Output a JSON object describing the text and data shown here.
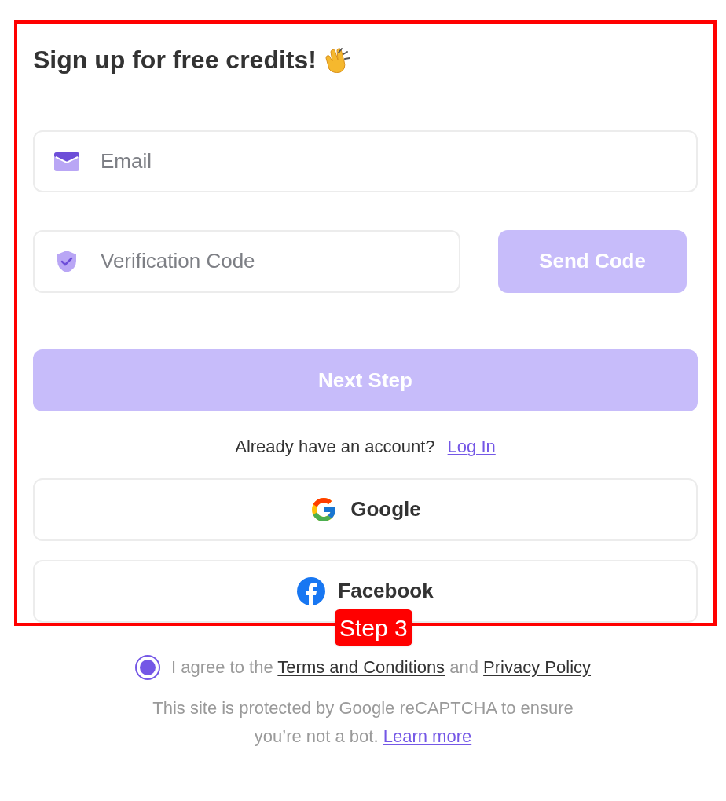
{
  "annotation": {
    "label": "Step 3"
  },
  "title": "Sign up for free credits!",
  "email_field": {
    "placeholder": "Email"
  },
  "code_field": {
    "placeholder": "Verification Code"
  },
  "send_code_button": {
    "label": "Send Code",
    "disabled": true
  },
  "next_step_button": {
    "label": "Next Step",
    "disabled": true
  },
  "login_prompt": {
    "text": "Already have an account?",
    "link": "Log In"
  },
  "social_buttons": [
    {
      "kind": "google",
      "label": "Google"
    },
    {
      "kind": "facebook",
      "label": "Facebook"
    }
  ],
  "agreement": {
    "checked": true,
    "prefix": "I agree to the",
    "terms_link": "Terms and Conditions",
    "middle": "and",
    "privacy_link": "Privacy Policy"
  },
  "recaptcha": {
    "text": "This site is protected by Google reCAPTCHA to ensure you’re not a bot.",
    "link": "Learn more"
  }
}
